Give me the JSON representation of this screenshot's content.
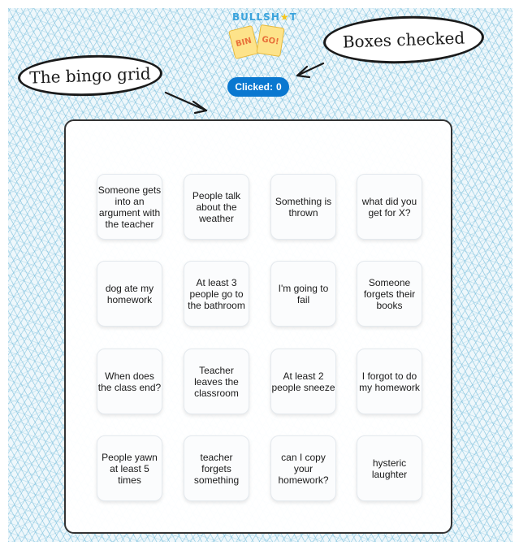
{
  "logo": {
    "text_left": "BULLSH",
    "text_star": "★",
    "text_right": "T",
    "card1": "BIN",
    "card2": "GO!"
  },
  "annotations": {
    "grid_label": "The bingo grid",
    "boxes_label": "Boxes checked"
  },
  "counter": {
    "label": "Clicked:",
    "value": "0"
  },
  "bingo": {
    "cells": [
      "Someone gets into an argument with the teacher",
      "People talk about the weather",
      "Something is thrown",
      "what did you get for X?",
      "dog ate my homework",
      "At least 3 people go to the bathroom",
      "I'm going to fail",
      "Someone forgets their books",
      "When does the class end?",
      "Teacher leaves the classroom",
      "At least 2 people sneeze",
      "I forgot to do my homework",
      "People yawn at least 5 times",
      "teacher forgets something",
      "can I copy your homework?",
      "hysteric laughter"
    ]
  },
  "colors": {
    "accent": "#0a78d0",
    "background_pattern": "#78bedc",
    "board_border": "#333333"
  }
}
